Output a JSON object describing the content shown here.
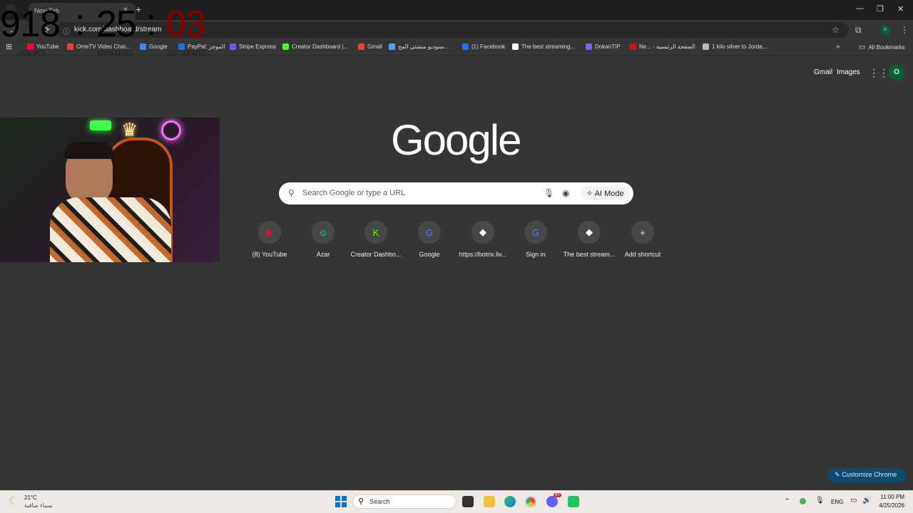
{
  "browser": {
    "tab_title": "New Tab",
    "url": "kick.com/dashboard/stream"
  },
  "timer": {
    "hours": "918",
    "sep1": ":",
    "minutes": "25",
    "sep2": ":",
    "seconds": "03",
    "hours_label": "HOURS",
    "minutes_label": "MINUTES",
    "seconds_label": "SECONDS"
  },
  "bookmarks": [
    {
      "label": "YouTube",
      "color": "#ff0033"
    },
    {
      "label": "OmeTV Video Chat...",
      "color": "#e0463c"
    },
    {
      "label": "Google",
      "color": "#4285f4"
    },
    {
      "label": "PayPal: الموجز",
      "color": "#1a73e8"
    },
    {
      "label": "Stripe Express",
      "color": "#635bff"
    },
    {
      "label": "Creator Dashboard |...",
      "color": "#53fc18"
    },
    {
      "label": "Gmail",
      "color": "#ea4335"
    },
    {
      "label": "ستوديو منشئي المح...",
      "color": "#4aa3ff"
    },
    {
      "label": "(1) Facebook",
      "color": "#1877f2"
    },
    {
      "label": "The best streaming...",
      "color": "#ffffff"
    },
    {
      "label": "DokanTIP",
      "color": "#7b61ff"
    },
    {
      "label": "Ne... - الصفحة الرئيسية",
      "color": "#e50914"
    },
    {
      "label": "1 kilo silver to Jorda...",
      "color": "#bbbbbb"
    }
  ],
  "all_bookmarks": "All Bookmarks",
  "google": {
    "logo": "Google",
    "search_placeholder": "Search Google or type a URL",
    "ai_mode": "AI Mode",
    "gmail": "Gmail",
    "images": "Images",
    "avatar": "O"
  },
  "shortcuts": [
    {
      "label": "(8) YouTube",
      "glyph": "▶",
      "color": "#ff0033"
    },
    {
      "label": "Azar",
      "glyph": "☺",
      "color": "#35e0a1"
    },
    {
      "label": "Creator Dashbo...",
      "glyph": "K",
      "color": "#53fc18"
    },
    {
      "label": "Google",
      "glyph": "G",
      "color": "#4285f4"
    },
    {
      "label": "https://botrix.liv...",
      "glyph": "◆",
      "color": "#ffffff"
    },
    {
      "label": "Sign in",
      "glyph": "G",
      "color": "#4285f4"
    },
    {
      "label": "The best stream...",
      "glyph": "◆",
      "color": "#ffffff"
    },
    {
      "label": "Add shortcut",
      "glyph": "+",
      "color": "#e8eaed"
    }
  ],
  "customize": "Customize Chrome",
  "taskbar": {
    "weather_temp": "21°C",
    "weather_desc": "سماء صافية",
    "search": "Search",
    "lang": "ENG",
    "time": "11:00 PM",
    "date": "4/25/2026",
    "badge": "9+"
  }
}
